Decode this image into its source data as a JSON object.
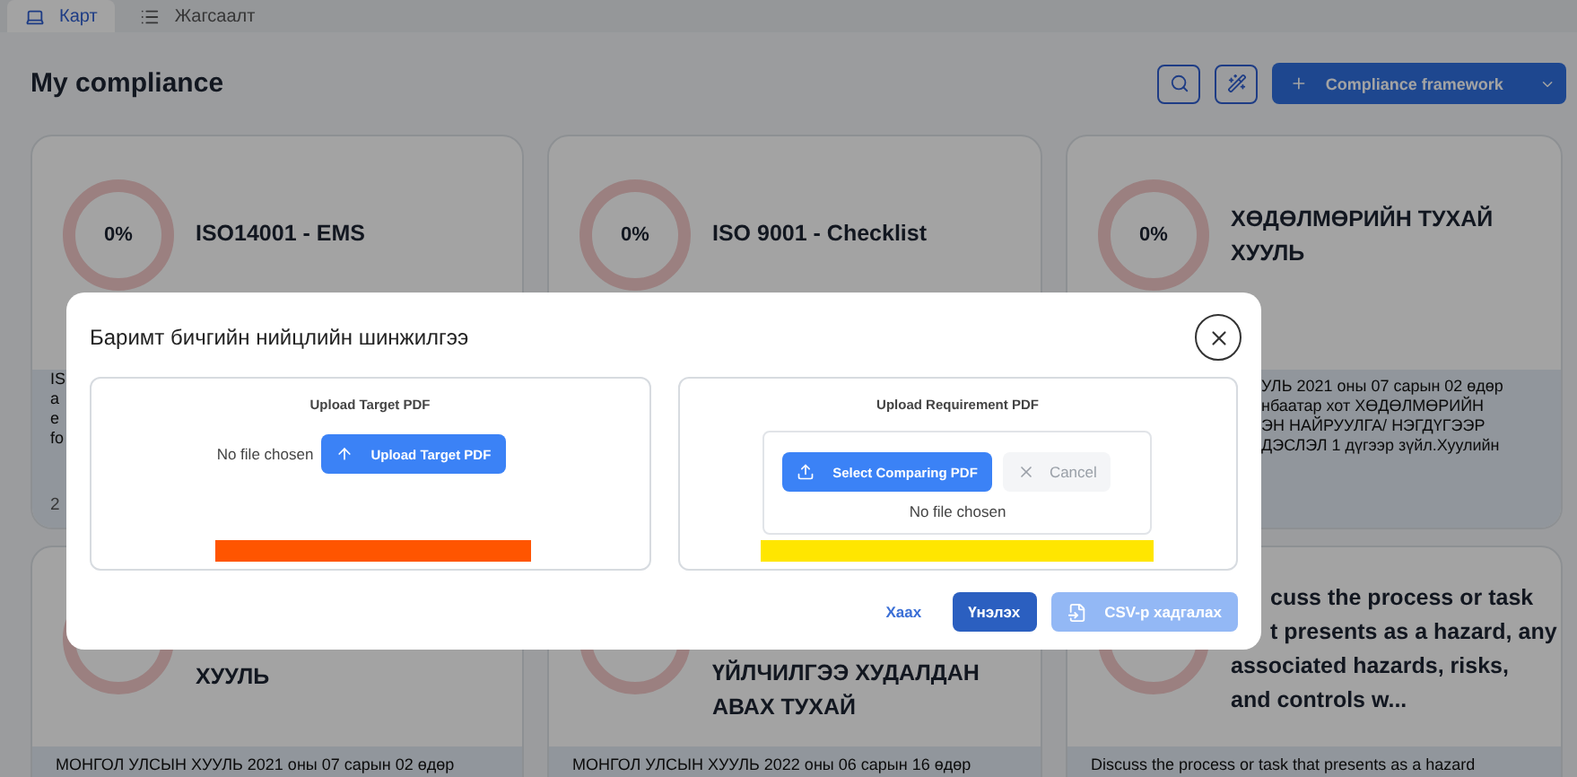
{
  "tabs": [
    {
      "label": "Карт",
      "selected": true
    },
    {
      "label": "Жагсаалт",
      "selected": false
    }
  ],
  "page_title": "My compliance",
  "add_button": "Compliance framework",
  "cards": [
    {
      "progress": "0%",
      "title_lines": [
        {
          "text": "ISO14001 - EMS",
          "kind": "full"
        }
      ],
      "description_lines": [
        {
          "text": "IS",
          "kind": "full"
        },
        {
          "text": "a",
          "kind": "full"
        },
        {
          "text": "e",
          "kind": "full"
        },
        {
          "text": "fo",
          "kind": "full"
        }
      ],
      "date": "2"
    },
    {
      "progress": "0%",
      "title_lines": [
        {
          "text": "ISO 9001 - Checklist",
          "kind": "full"
        }
      ]
    },
    {
      "progress": "0%",
      "title_lines": [
        {
          "text": "ХӨДӨЛМӨРИЙН ТУХАЙ",
          "kind": "full"
        },
        {
          "text": "ХУУЛЬ",
          "kind": "full"
        }
      ],
      "description_lines": [
        {
          "text": "УЛЬ 2021 оны 07 сарын 02 өдөр",
          "kind": "cut"
        },
        {
          "text": "нбаатар хот ХӨДӨЛМӨРИЙН",
          "kind": "cut"
        },
        {
          "text": "ЭН НАЙРУУЛГА/ НЭГДҮГЭЭР",
          "kind": "cut"
        },
        {
          "text": "ДЭСЛЭЛ 1 дүгээр зүйл.Хуулийн",
          "kind": "cut"
        }
      ]
    },
    {
      "title_lines": [
        {
          "text": "ХУУЛЬ",
          "kind": "full"
        }
      ],
      "description_lines": [
        {
          "text": "МОНГОЛ УЛСЫН ХУУЛЬ 2021 оны 07 сарын 02 өдөр",
          "kind": "full"
        }
      ]
    },
    {
      "title_lines": [
        {
          "text": "ҮЙЛЧИЛГЭЭ ХУДАЛДАН",
          "kind": "full"
        },
        {
          "text": "АВАХ ТУХАЙ",
          "kind": "full"
        }
      ],
      "description_lines": [
        {
          "text": "МОНГОЛ УЛСЫН ХУУЛЬ 2022 оны 06 сарын 16 өдөр",
          "kind": "full"
        }
      ]
    },
    {
      "title_lines": [
        {
          "text": "cuss the process or task",
          "kind": "cut"
        },
        {
          "text": "t presents as a hazard, any",
          "kind": "cut"
        },
        {
          "text": "associated hazards, risks,",
          "kind": "full"
        },
        {
          "text": "and controls w...",
          "kind": "full"
        }
      ],
      "description_lines": [
        {
          "text": "Discuss the process or task that presents as a hazard",
          "kind": "full"
        }
      ]
    }
  ],
  "dialog": {
    "title": "Баримт бичгийн нийцлийн шинжилгээ",
    "panels": [
      {
        "heading": "Upload Target PDF",
        "kind": "simple",
        "status": "No file chosen",
        "button": "Upload Target PDF",
        "color": "#ff5500"
      },
      {
        "heading": "Upload Requirement PDF",
        "kind": "box",
        "status": "No file chosen",
        "button": "Select Comparing PDF",
        "cancel": "Cancel",
        "color": "#ffe600"
      }
    ],
    "buttons": [
      {
        "label": "Хаах",
        "kind": "link",
        "disabled": false
      },
      {
        "label": "Үнэлэх",
        "kind": "primary",
        "disabled": false
      },
      {
        "label": "CSV-р хадгалах",
        "kind": "primary",
        "disabled": true
      }
    ]
  }
}
